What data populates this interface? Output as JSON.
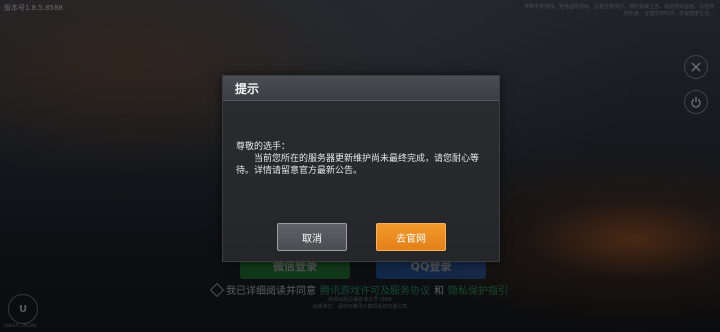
{
  "version": "版本号1.8.5.8588",
  "health_notice": "抵制不良游戏，拒绝盗版游戏。注意自我保护，谨防受骗上当。适度游戏益脑，沉迷游戏伤身。合理安排时间，享受健康生活。",
  "login": {
    "wechat_label": "微信登录",
    "qq_label": "QQ登录",
    "agree_prefix": "我已详细阅读并同意",
    "agree_link1": "腾讯游戏许可及服务协议",
    "agree_and": "和",
    "agree_link2": "隐私保护指引"
  },
  "footer": {
    "line1": "新闻出版总署批准文号 ISBN",
    "line2": "出版单位：深圳市腾讯计算机系统有限公司"
  },
  "engine_label": "UNREAL ENGINE",
  "dialog": {
    "title": "提示",
    "greeting": "尊敬的选手：",
    "message": "当前您所在的服务器更新维护尚未最终完成，请您耐心等待。详情请留意官方最新公告。",
    "cancel_label": "取消",
    "official_label": "去官网"
  },
  "colors": {
    "accent_orange": "#f39a2a",
    "wechat_green": "#27a43a",
    "qq_blue": "#2b6fd6"
  }
}
